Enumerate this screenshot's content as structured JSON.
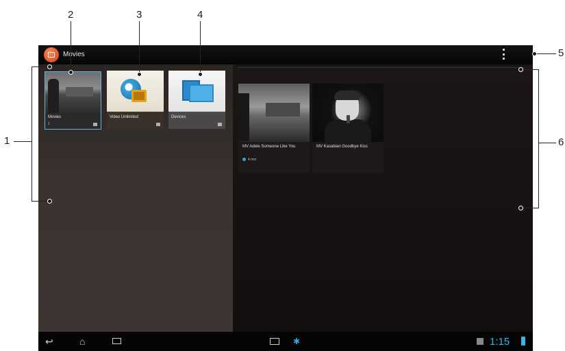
{
  "actionbar": {
    "app_title": "Movies"
  },
  "tiles": [
    {
      "label": "Movies",
      "sub": "1",
      "icon": "movies-thumbnail"
    },
    {
      "label": "Video Unlimited",
      "icon": "video-unlimited-icon"
    },
    {
      "label": "Devices",
      "icon": "devices-icon"
    }
  ],
  "videos": [
    {
      "title": "MV Adele Someone Like You",
      "meta": "4 min"
    },
    {
      "title": "MV Kasabian Goodbye Kiss"
    }
  ],
  "statusbar": {
    "clock": "1:15"
  },
  "callouts": [
    "1",
    "2",
    "3",
    "4",
    "5",
    "6"
  ],
  "colors": {
    "accent": "#33b5e5",
    "app_icon": "#e2542a"
  }
}
